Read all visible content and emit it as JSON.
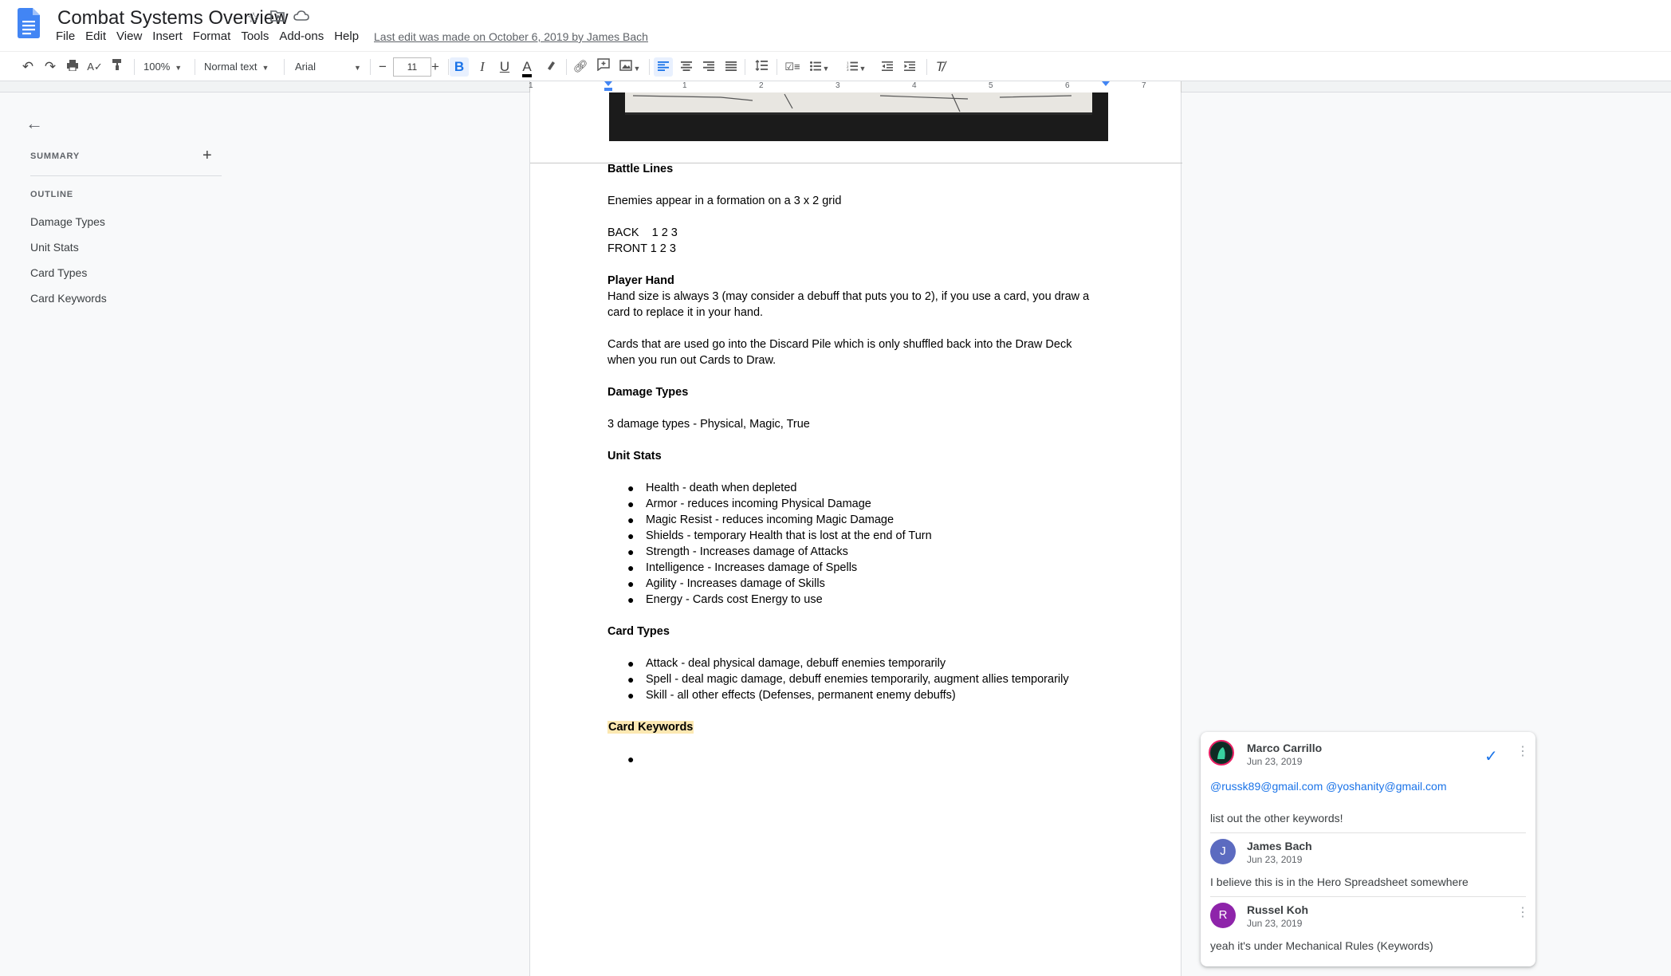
{
  "app": {
    "doc_title": "Combat Systems Overview",
    "last_edit": "Last edit was made on October 6, 2019 by James Bach",
    "menu": [
      "File",
      "Edit",
      "View",
      "Insert",
      "Format",
      "Tools",
      "Add-ons",
      "Help"
    ]
  },
  "toolbar": {
    "zoom": "100%",
    "style": "Normal text",
    "font": "Arial",
    "font_size": "11"
  },
  "ruler": {
    "marks": [
      "1",
      "1",
      "2",
      "3",
      "4",
      "5",
      "6",
      "7"
    ]
  },
  "outline": {
    "summary_label": "SUMMARY",
    "outline_label": "OUTLINE",
    "items": [
      "Damage Types",
      "Unit Stats",
      "Card Types",
      "Card Keywords"
    ]
  },
  "document": {
    "battle_lines_heading": "Battle Lines",
    "battle_lines_text": "Enemies appear in a formation on a 3 x 2 grid",
    "back_row": "BACK    1 2 3",
    "front_row": "FRONT 1 2 3",
    "player_hand_heading": "Player Hand",
    "player_hand_line1": "Hand size is always 3 (may consider a debuff that puts you to 2), if you use a card, you draw a",
    "player_hand_line2": "card to replace it in your hand.",
    "discard_line1": "Cards that are used go into the Discard Pile which is only shuffled back into the Draw Deck",
    "discard_line2": "when you run out Cards to Draw.",
    "damage_types_heading": "Damage Types",
    "damage_types_text": "3 damage types - Physical, Magic, True",
    "unit_stats_heading": "Unit Stats",
    "unit_stats": [
      "Health - death when depleted",
      "Armor - reduces incoming Physical Damage",
      "Magic Resist - reduces incoming Magic Damage",
      "Shields - temporary Health that is lost at the end of Turn",
      "Strength - Increases damage of Attacks",
      "Intelligence - Increases damage of Spells",
      "Agility - Increases damage of Skills",
      "Energy - Cards cost Energy to use"
    ],
    "card_types_heading": "Card Types",
    "card_types": [
      "Attack - deal physical damage, debuff enemies temporarily",
      "Spell - deal magic damage, debuff enemies temporarily, augment allies temporarily",
      "Skill - all other effects (Defenses, permanent enemy debuffs)"
    ],
    "card_keywords_heading": "Card Keywords"
  },
  "comments": [
    {
      "name": "Marco Carrillo",
      "date": "Jun 23, 2019",
      "mention1": "@russk89@gmail.com",
      "mention2": "@yoshanity@gmail.com",
      "text": "list out the other keywords!"
    },
    {
      "name": "James Bach",
      "initial": "J",
      "date": "Jun 23, 2019",
      "text": "I believe this is in the Hero Spreadsheet somewhere"
    },
    {
      "name": "Russel Koh",
      "initial": "R",
      "date": "Jun 23, 2019",
      "text": "yeah it's under Mechanical Rules (Keywords)"
    }
  ],
  "colors": {
    "accent": "#1a73e8",
    "highlight": "#fce8b2",
    "avatar_james": "#5c6bc0",
    "avatar_russel": "#8e24aa"
  }
}
